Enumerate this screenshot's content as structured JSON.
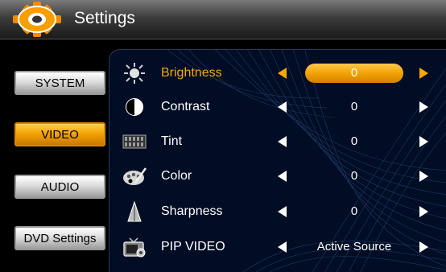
{
  "header": {
    "title": "Settings",
    "icon": "gear-icon"
  },
  "nav": {
    "items": [
      {
        "label": "SYSTEM",
        "active": false
      },
      {
        "label": "VIDEO",
        "active": true
      },
      {
        "label": "AUDIO",
        "active": false
      },
      {
        "label": "DVD Settings",
        "active": false
      }
    ]
  },
  "settings": [
    {
      "label": "Brightness",
      "value": "0",
      "icon": "brightness-icon",
      "selected": true
    },
    {
      "label": "Contrast",
      "value": "0",
      "icon": "contrast-icon",
      "selected": false
    },
    {
      "label": "Tint",
      "value": "0",
      "icon": "tint-icon",
      "selected": false
    },
    {
      "label": "Color",
      "value": "0",
      "icon": "color-palette-icon",
      "selected": false
    },
    {
      "label": "Sharpness",
      "value": "0",
      "icon": "sharpness-icon",
      "selected": false
    },
    {
      "label": "PIP VIDEO",
      "value": "Active Source",
      "icon": "pip-video-icon",
      "selected": false
    }
  ],
  "colors": {
    "accent": "#f5a800",
    "background": "#000000",
    "panel": "#000d24"
  }
}
